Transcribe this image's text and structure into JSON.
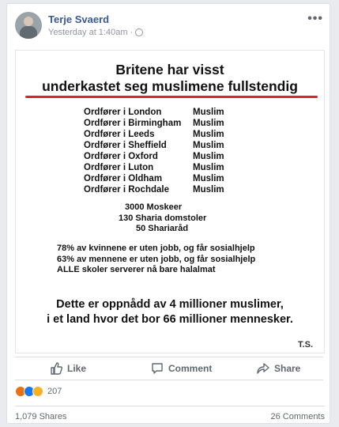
{
  "post": {
    "author": "Terje Svaerd",
    "timestamp": "Yesterday at 1:40am",
    "separator": "·",
    "more_icon": "more-dots-icon"
  },
  "image": {
    "title_line1": "Britene har visst",
    "title_line2": "underkastet seg muslimene fullstendig",
    "mayors": [
      {
        "city": "Ordfører i London",
        "rel": "Muslim"
      },
      {
        "city": "Ordfører i Birmingham",
        "rel": "Muslim"
      },
      {
        "city": "Ordfører i Leeds",
        "rel": "Muslim"
      },
      {
        "city": "Ordfører i Sheffield",
        "rel": "Muslim"
      },
      {
        "city": "Ordfører i Oxford",
        "rel": "Muslim"
      },
      {
        "city": "Ordfører i Luton",
        "rel": "Muslim"
      },
      {
        "city": "Ordfører i Oldham",
        "rel": "Muslim"
      },
      {
        "city": "Ordfører i Rochdale",
        "rel": "Muslim"
      }
    ],
    "stats1": [
      "3000 Moskeer",
      "130 Sharia domstoler",
      "50 Shariaråd"
    ],
    "stats2": [
      "78% av kvinnene er uten jobb, og får sosialhjelp",
      "63% av mennene er uten jobb, og får sosialhjelp",
      "ALLE skoler serverer nå bare halalmat"
    ],
    "conclusion_line1": "Dette er oppnådd av 4 millioner muslimer,",
    "conclusion_line2": "i et land hvor det bor 66 millioner mennesker.",
    "signature": "T.S.",
    "accent_color": "#d9252a"
  },
  "actions": {
    "like": "Like",
    "comment": "Comment",
    "share": "Share"
  },
  "reactions": {
    "icons": [
      "angry-reaction-icon",
      "like-reaction-icon",
      "sad-reaction-icon"
    ],
    "count": "207"
  },
  "footer": {
    "shares": "1,079 Shares",
    "comments": "26 Comments"
  },
  "colors": {
    "link": "#385898",
    "muted": "#90949c"
  }
}
